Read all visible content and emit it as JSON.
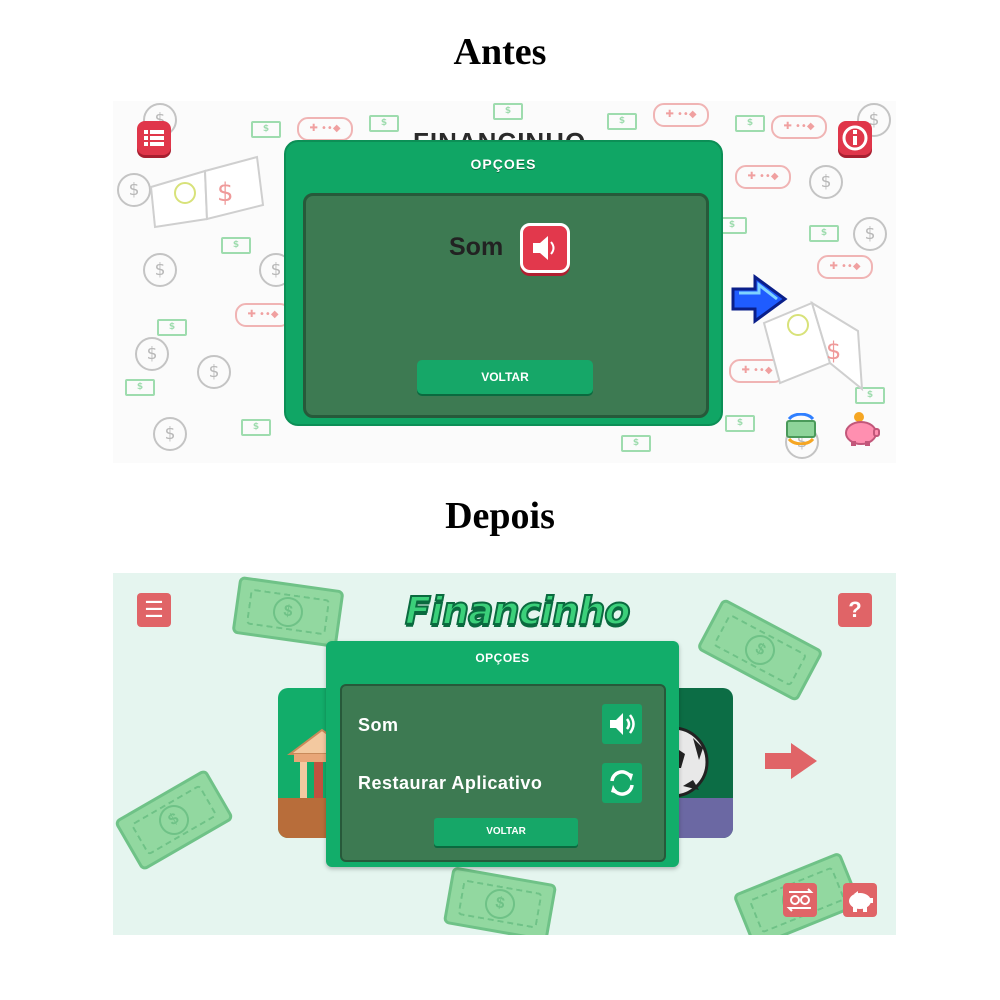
{
  "headings": {
    "before": "Antes",
    "after": "Depois"
  },
  "before": {
    "title_partial": "FINANCINHO",
    "modal": {
      "title": "OPÇOES",
      "som_label": "Som",
      "back_label": "VOLTAR"
    },
    "icons": {
      "menu": "list-icon",
      "info": "info-icon",
      "next": "blue-arrow-icon",
      "exchange": "money-exchange-icon",
      "piggy": "piggy-bank-icon",
      "sound": "speaker-icon"
    },
    "colors": {
      "accent_green": "#10a665",
      "inner_green": "#3d7a52",
      "button_red": "#e0364a",
      "arrow_blue": "#1f5cff"
    }
  },
  "after": {
    "logo": "Financinho",
    "modal": {
      "title": "OPÇOES",
      "som_label": "Som",
      "restore_label": "Restaurar Aplicativo",
      "back_label": "VOLTAR"
    },
    "icons": {
      "menu": "hamburger-icon",
      "help": "question-icon",
      "sound": "volume-icon",
      "restore": "sync-icon",
      "next": "arrow-right-icon",
      "exchange": "money-exchange-icon",
      "piggy": "piggy-bank-icon"
    },
    "menu_glyph": "☰",
    "help_glyph": "?",
    "colors": {
      "background": "#e5f5ef",
      "accent_green": "#12ad6a",
      "inner_green": "#3d7a52",
      "button_red": "#e06467"
    }
  }
}
